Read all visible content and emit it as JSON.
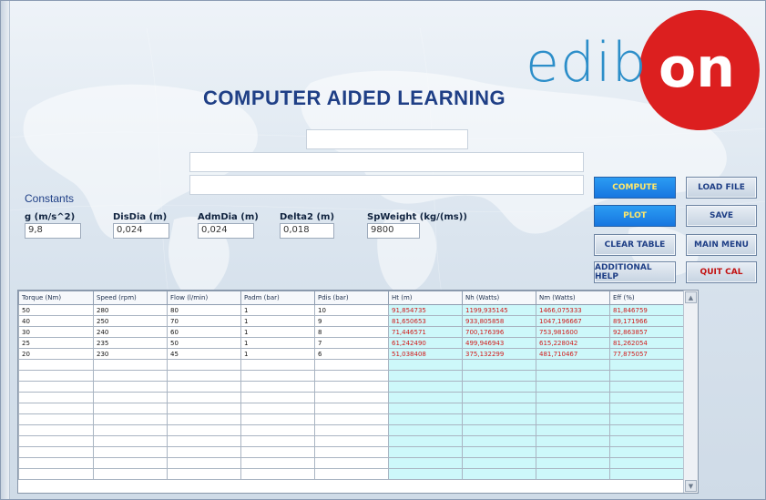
{
  "logo": {
    "prefix": "edib",
    "circle_text": "on"
  },
  "title": "COMPUTER AIDED LEARNING",
  "constants": {
    "heading": "Constants",
    "fields": [
      {
        "label": "g (m/s^2)",
        "value": "9,8"
      },
      {
        "label": "DisDia (m)",
        "value": "0,024"
      },
      {
        "label": "AdmDia (m)",
        "value": "0,024"
      },
      {
        "label": "Delta2 (m)",
        "value": "0,018"
      },
      {
        "label": "SpWeight (kg/(ms))",
        "value": "9800"
      }
    ]
  },
  "buttons": {
    "compute": "COMPUTE",
    "load_file": "LOAD FILE",
    "plot": "PLOT",
    "save": "SAVE",
    "clear_table": "CLEAR TABLE",
    "main_menu": "MAIN MENU",
    "additional_help": "ADDITIONAL HELP",
    "quit_cal": "QUIT CAL"
  },
  "table": {
    "columns": [
      "Torque (Nm)",
      "Speed (rpm)",
      "Flow (l/min)",
      "Padm (bar)",
      "Pdis (bar)",
      "Ht (m)",
      "Nh (Watts)",
      "Nm (Watts)",
      "Eff (%)"
    ],
    "rows": [
      [
        "50",
        "280",
        "80",
        "1",
        "10",
        "91,854735",
        "1199,935145",
        "1466,075333",
        "81,846759"
      ],
      [
        "40",
        "250",
        "70",
        "1",
        "9",
        "81,650653",
        "933,805858",
        "1047,196667",
        "89,171966"
      ],
      [
        "30",
        "240",
        "60",
        "1",
        "8",
        "71,446571",
        "700,176396",
        "753,981600",
        "92,863857"
      ],
      [
        "25",
        "235",
        "50",
        "1",
        "7",
        "61,242490",
        "499,946943",
        "615,228042",
        "81,262054"
      ],
      [
        "20",
        "230",
        "45",
        "1",
        "6",
        "51,038408",
        "375,132299",
        "481,710467",
        "77,875057"
      ]
    ],
    "empty_rows": 11
  },
  "colors": {
    "title": "#1f3f86",
    "logo_blue": "#2c8ec9",
    "logo_red": "#dc1f1f",
    "accent_button": "#1776e0",
    "calc_cells": "#cdf8fa",
    "calc_text": "#d11a1a"
  }
}
